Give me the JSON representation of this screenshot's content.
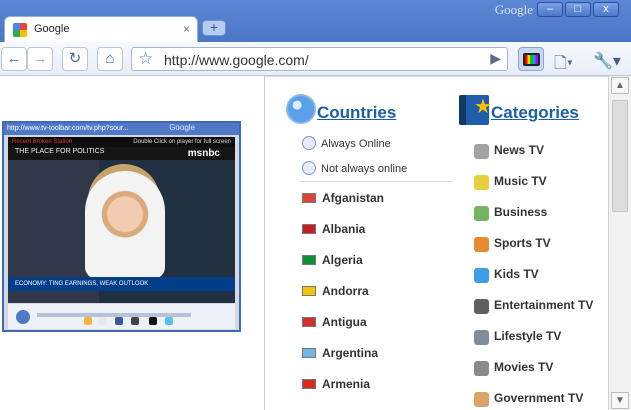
{
  "browser": {
    "brand": "Google",
    "tab": {
      "title": "Google"
    },
    "address": {
      "url": "http://www.google.com/"
    }
  },
  "player": {
    "title": "http://www.tv-toolbar.com/tv.php?sour...",
    "brand": "Google",
    "hint_left": "Recent Broken Station",
    "hint_right": "Double Click on player for full screen",
    "channel_label": "THE PLACE FOR POLITICS",
    "logo": "msnbc",
    "ticker": "ECONOMY: TING EARNINGS, WEAK OUTLOOK"
  },
  "popup": {
    "countries_title": "Countries",
    "categories_title": "Categories",
    "online_options": [
      {
        "label": "Always Online"
      },
      {
        "label": "Not always online"
      }
    ],
    "countries": [
      {
        "name": "Afganistan",
        "flag_color": "#d94635"
      },
      {
        "name": "Albania",
        "flag_color": "#c61d23"
      },
      {
        "name": "Algeria",
        "flag_color": "#0f8f3a"
      },
      {
        "name": "Andorra",
        "flag_color": "#f2c40d"
      },
      {
        "name": "Antigua",
        "flag_color": "#d2302b"
      },
      {
        "name": "Argentina",
        "flag_color": "#73b6e8"
      },
      {
        "name": "Armenia",
        "flag_color": "#d52b1e"
      }
    ],
    "categories": [
      {
        "name": "News TV",
        "icon": "news-icon",
        "color": "#a3a3a3"
      },
      {
        "name": "Music TV",
        "icon": "music-icon",
        "color": "#e5cf3c"
      },
      {
        "name": "Business",
        "icon": "business-icon",
        "color": "#74b464"
      },
      {
        "name": "Sports TV",
        "icon": "sports-icon",
        "color": "#e68b32"
      },
      {
        "name": "Kids TV",
        "icon": "kids-icon",
        "color": "#3e9de5"
      },
      {
        "name": "Entertainment TV",
        "icon": "entertainment-icon",
        "color": "#5f5f5f"
      },
      {
        "name": "Lifestyle TV",
        "icon": "lifestyle-icon",
        "color": "#7d8f9e"
      },
      {
        "name": "Movies TV",
        "icon": "movies-icon",
        "color": "#8a8a8a"
      },
      {
        "name": "Government TV",
        "icon": "government-icon",
        "color": "#d9a36a"
      }
    ]
  }
}
